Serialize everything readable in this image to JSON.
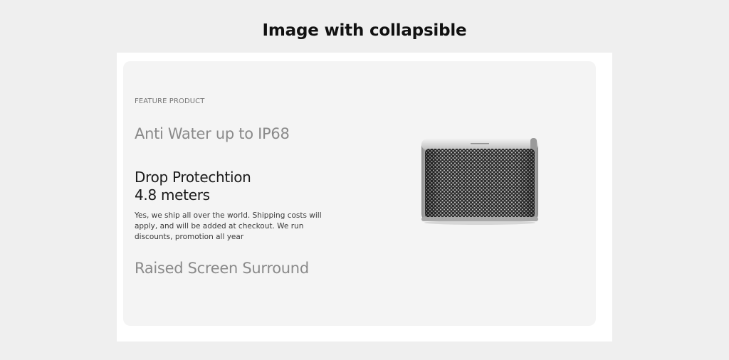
{
  "page": {
    "title": "Image with collapsible"
  },
  "section": {
    "eyebrow": "FEATURE PRODUCT",
    "items": [
      {
        "heading": "Anti Water up to IP68",
        "expanded": false
      },
      {
        "heading_line1": "Drop Protechtion",
        "heading_line2": "4.8 meters",
        "expanded": true,
        "body": "Yes, we ship all over the world. Shipping costs will apply, and will be added at checkout. We run discounts, promotion all year"
      },
      {
        "heading": "Raised Screen Surround",
        "expanded": false
      }
    ],
    "image": {
      "icon": "speaker-product-image"
    }
  },
  "colors": {
    "page_background": "#efefef",
    "frame_background": "#ffffff",
    "card_background": "#f4f4f4",
    "collapsed_heading": "#8a8a8a",
    "expanded_heading": "#1a1a1a"
  }
}
